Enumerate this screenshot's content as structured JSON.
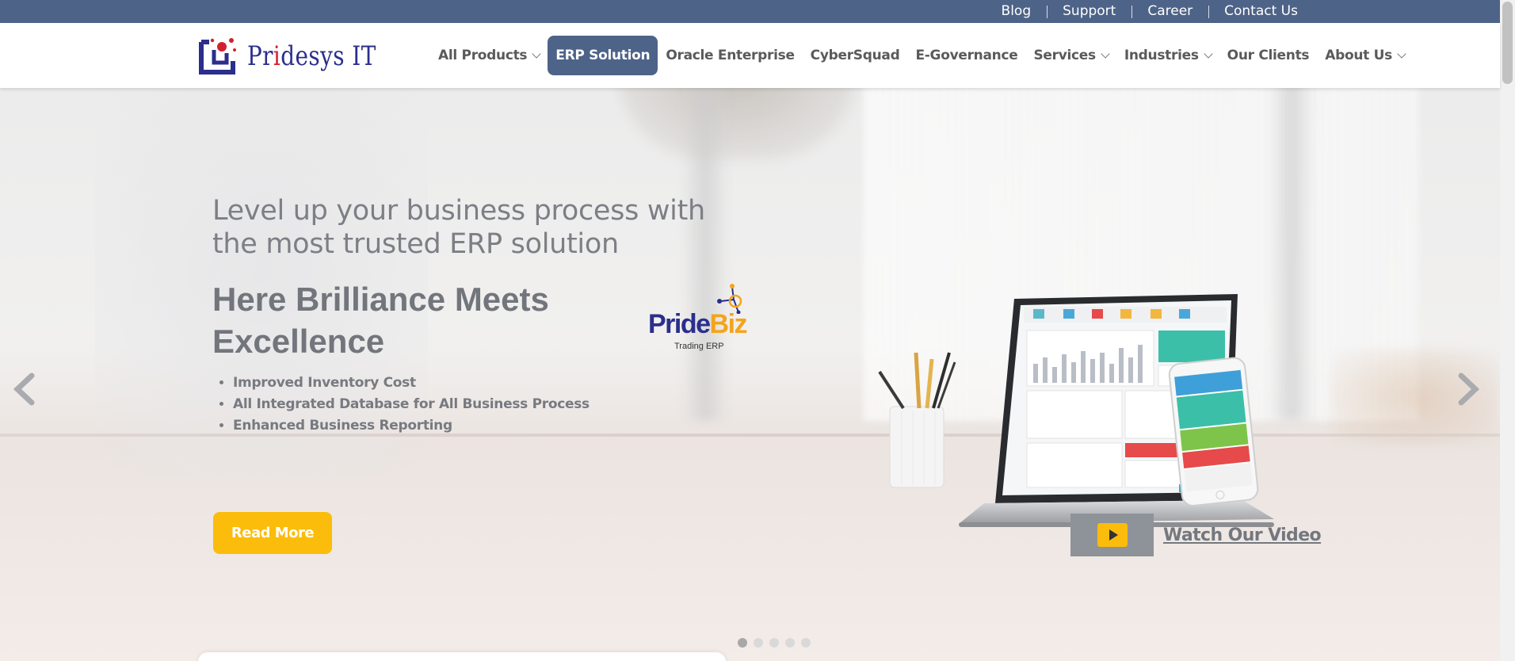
{
  "topbar": {
    "links": [
      "Blog",
      "Support",
      "Career",
      "Contact Us"
    ]
  },
  "header": {
    "logo_text_prefix": "Pr",
    "logo_text_accent": "i",
    "logo_text_suffix": "desys IT",
    "nav": [
      {
        "label": "All Products",
        "dropdown": true
      },
      {
        "label": "ERP Solution",
        "dropdown": false,
        "active": true
      },
      {
        "label": "Oracle Enterprise",
        "dropdown": false
      },
      {
        "label": "CyberSquad",
        "dropdown": false
      },
      {
        "label": "E-Governance",
        "dropdown": false
      },
      {
        "label": "Services",
        "dropdown": true
      },
      {
        "label": "Industries",
        "dropdown": true
      },
      {
        "label": "Our Clients",
        "dropdown": false
      },
      {
        "label": "About Us",
        "dropdown": true
      }
    ]
  },
  "hero": {
    "tagline": "Level up your business process with the most trusted ERP solution",
    "headline": "Here Brilliance Meets Excellence",
    "bullets": [
      "Improved Inventory Cost",
      "All Integrated Database for All Business Process",
      "Enhanced Business Reporting"
    ],
    "read_more_label": "Read More",
    "product_logo_part1": "Pride",
    "product_logo_part2": "Biz",
    "product_logo_sub": "Trading ERP",
    "video_link_label": "Watch Our Video",
    "slide_count": 5,
    "active_slide": 1
  },
  "colors": {
    "brand": "#4e6388",
    "accent": "#fbbc0b",
    "logo_blue": "#2b2e8c",
    "logo_red": "#d3202f"
  },
  "icons": {
    "prev": "chevron-left-icon",
    "next": "chevron-right-icon",
    "play": "play-icon",
    "dropdown": "chevron-down-icon"
  }
}
